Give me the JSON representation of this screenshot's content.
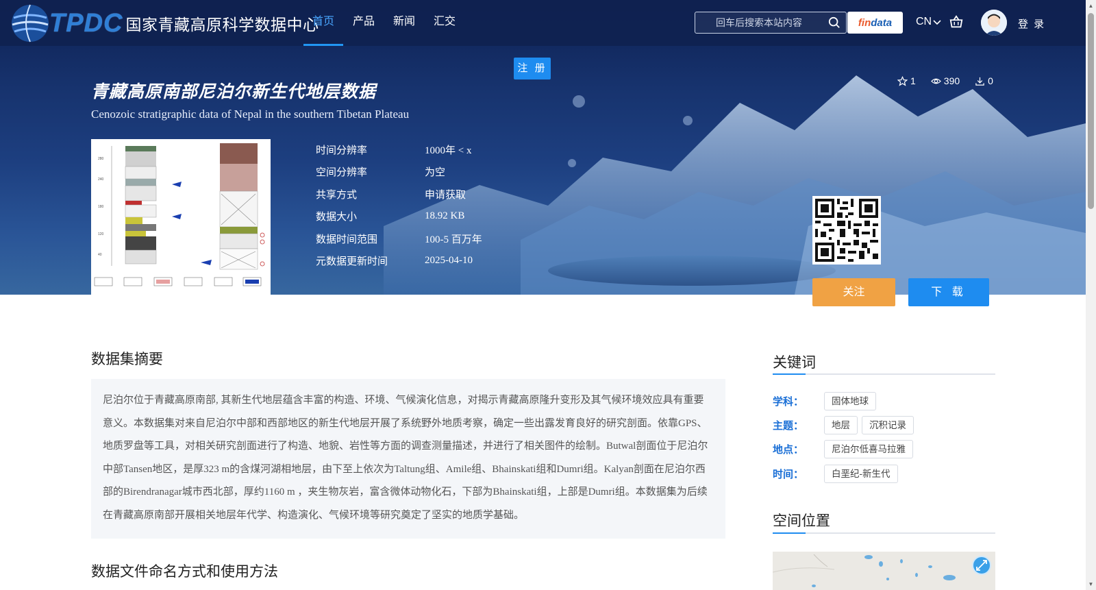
{
  "header": {
    "logo_text": "TPDC",
    "logo_cn": "国家青藏高原科学数据中心",
    "nav": [
      {
        "label": "首页",
        "active": true
      },
      {
        "label": "产品",
        "active": false
      },
      {
        "label": "新闻",
        "active": false
      },
      {
        "label": "汇交",
        "active": false
      }
    ],
    "search_placeholder": "回车后搜索本站内容",
    "findata_label_a": "fin",
    "findata_label_b": "data",
    "lang": "CN",
    "login": "登 录"
  },
  "register_label": "注 册",
  "dataset": {
    "title": "青藏高原南部尼泊尔新生代地层数据",
    "subtitle": "Cenozoic stratigraphic data of Nepal in the southern Tibetan Plateau",
    "stats": {
      "favorites": "1",
      "views": "390",
      "downloads": "0"
    },
    "meta": [
      {
        "key": "时间分辨率",
        "value": "1000年 < x"
      },
      {
        "key": "空间分辨率",
        "value": "为空"
      },
      {
        "key": "共享方式",
        "value": "申请获取"
      },
      {
        "key": "数据大小",
        "value": "18.92 KB"
      },
      {
        "key": "数据时间范围",
        "value": "100-5 百万年"
      },
      {
        "key": "元数据更新时间",
        "value": "2025-04-10"
      }
    ],
    "follow_label": "关注",
    "download_label": "下 载"
  },
  "abstract": {
    "title": "数据集摘要",
    "text": "尼泊尔位于青藏高原南部, 其新生代地层蕴含丰富的构造、环境、气候演化信息，对揭示青藏高原隆升变形及其气候环境效应具有重要意义。本数据集对来自尼泊尔中部和西部地区的新生代地层开展了系统野外地质考察，确定一些出露发育良好的研究剖面。依靠GPS、地质罗盘等工具，对相关研究剖面进行了构造、地貌、岩性等方面的调查测量描述，并进行了相关图件的绘制。Butwal剖面位于尼泊尔中部Tansen地区，是厚323 m的含煤河湖相地层，由下至上依次为Taltung组、Amile组、Bhainskati组和Dumri组。Kalyan剖面在尼泊尔西部的Birendranagar城市西北部，厚约1160 m ，夹生物灰岩，富含微体动物化石，下部为Bhainskati组，上部是Dumri组。本数据集为后续在青藏高原南部开展相关地层年代学、构造演化、气候环境等研究奠定了坚实的地质学基础。"
  },
  "naming": {
    "title": "数据文件命名方式和使用方法"
  },
  "keywords": {
    "title": "关键词",
    "rows": [
      {
        "label": "学科：",
        "tags": [
          "固体地球"
        ]
      },
      {
        "label": "主题：",
        "tags": [
          "地层",
          "沉积记录"
        ]
      },
      {
        "label": "地点：",
        "tags": [
          "尼泊尔低喜马拉雅"
        ]
      },
      {
        "label": "时间：",
        "tags": [
          "白垩纪-新生代"
        ]
      }
    ]
  },
  "location": {
    "title": "空间位置"
  },
  "colors": {
    "accent": "#1e8cf0",
    "follow": "#f0a244",
    "keyword_label": "#1a6fd6"
  }
}
